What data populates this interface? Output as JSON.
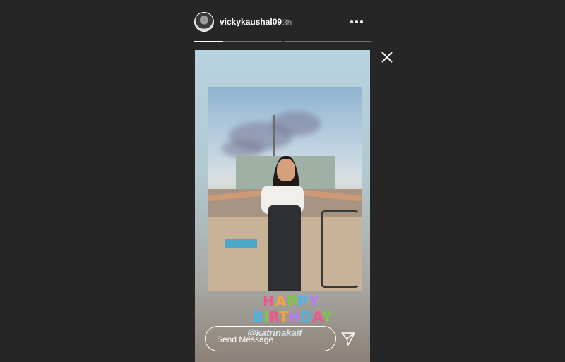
{
  "header": {
    "username": "vickykaushal09",
    "time": "3h"
  },
  "progress": {
    "segments": 2,
    "current_fill_fraction": 0.33
  },
  "story": {
    "sticker_line1": [
      "H",
      "A",
      "P",
      "P",
      "Y"
    ],
    "sticker_line2": [
      "B",
      "I",
      "R",
      "T",
      "H",
      "D",
      "A",
      "Y"
    ],
    "mention": "@katrinakaif"
  },
  "reply": {
    "placeholder": "Send Message"
  },
  "colors": {
    "background": "#262626",
    "text": "#ffffff"
  },
  "icons": {
    "more": "more-horizontal-icon",
    "close": "close-icon",
    "send": "paper-plane-icon"
  }
}
